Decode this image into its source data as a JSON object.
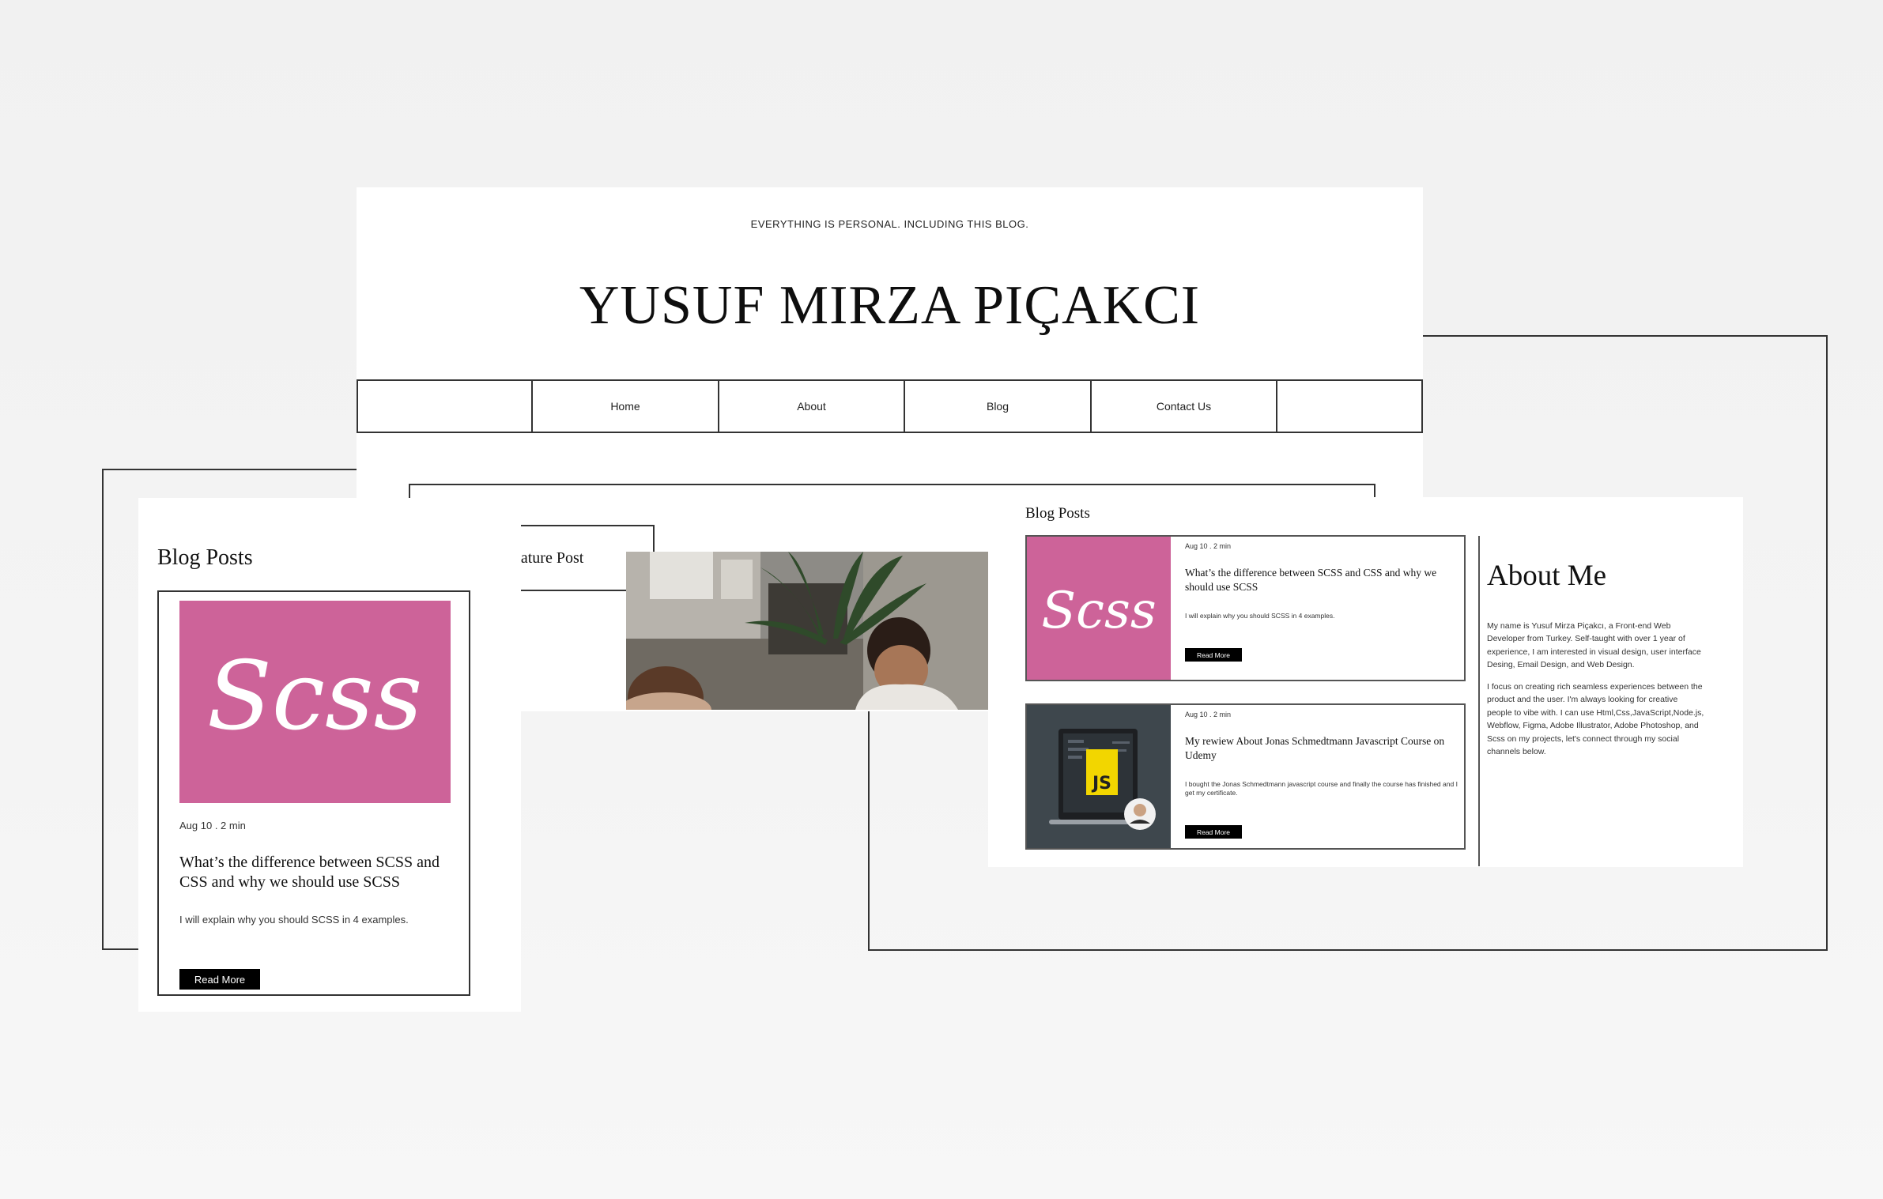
{
  "site": {
    "tagline": "EVERYTHING IS PERSONAL. INCLUDING THIS BLOG.",
    "title": "YUSUF MIRZA PIÇAKCI"
  },
  "nav": {
    "items": [
      "Home",
      "About",
      "Blog",
      "Contact Us"
    ]
  },
  "featured": {
    "label": "eature Post"
  },
  "left_panel": {
    "heading": "Blog Posts",
    "card": {
      "thumb_text": "Scss",
      "meta": "Aug 10 . 2 min",
      "title": "What’s the difference between SCSS and CSS and why we should use SCSS",
      "excerpt": "I will explain why you should SCSS in 4 examples.",
      "button": "Read More"
    }
  },
  "right_panel": {
    "heading": "Blog Posts",
    "posts": [
      {
        "thumb_text": "Scss",
        "meta": "Aug 10 . 2 min",
        "title": "What’s the difference between SCSS and CSS and why we should use SCSS",
        "excerpt": "I will explain why you should SCSS in 4 examples.",
        "button": "Read More"
      },
      {
        "thumb_text": "JS",
        "meta": "Aug 10 . 2 min",
        "title": "My rewiew About Jonas Schmedtmann Javascript Course on Udemy",
        "excerpt": "I bought the Jonas Schmedtmann javascript course and finally the course has finished and I get my certificate.",
        "button": "Read More"
      }
    ],
    "about": {
      "heading": "About Me",
      "paragraph_1": "My name is Yusuf Mirza Piçakcı, a Front-end Web Developer from Turkey. Self-taught with over 1 year of experience, I am interested in visual design, user interface Desing, Email Design, and Web Design.",
      "paragraph_2": "I focus on creating rich seamless experiences between the product and the user. I'm always looking for creative people to vibe with. I can use Html,Css,JavaScript,Node.js, Webflow, Figma, Adobe Illustrator, Adobe Photoshop, and Scss on my projects, let's connect through my social channels below."
    }
  },
  "colors": {
    "scss_pink": "#cd6399",
    "button_bg": "#000000",
    "js_yellow": "#f2d600"
  },
  "icons": [
    "scss-logo-icon",
    "js-logo-icon"
  ]
}
